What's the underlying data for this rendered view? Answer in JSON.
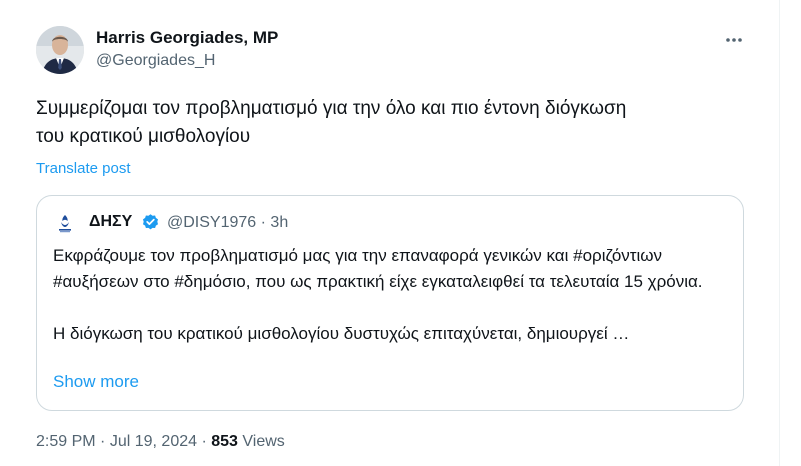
{
  "author": {
    "name": "Harris Georgiades, MP",
    "handle": "@Georgiades_H"
  },
  "post": {
    "text": "Συμμερίζομαι τον προβληματισμό για την όλο και πιο έντονη διόγκωση\nτου κρατικού μισθολογίου",
    "translate_label": "Translate post"
  },
  "quoted": {
    "name": "ΔΗΣΥ",
    "handle": "@DISY1976",
    "separator": "·",
    "time": "3h",
    "paragraph1": "Εκφράζουμε τον προβληματισμό μας για την επαναφορά γενικών και #οριζόντιων #αυξήσεων στο #δημόσιο, που ως πρακτική είχε εγκαταλειφθεί τα τελευταία 15 χρόνια.",
    "paragraph2": "Η διόγκωση του κρατικού μισθολογίου δυστυχώς επιταχύνεται, δημιουργεί …",
    "show_more": "Show more",
    "verified_color": "#1d9bf0"
  },
  "meta": {
    "time": "2:59 PM",
    "separator": "·",
    "date": "Jul 19, 2024",
    "views_count": "853",
    "views_label": "Views"
  },
  "icons": {
    "more": "more-horizontal-icon",
    "verified": "verified-badge-icon"
  },
  "colors": {
    "link": "#1d9bf0",
    "secondary_text": "#536471",
    "border": "#cfd9de"
  }
}
